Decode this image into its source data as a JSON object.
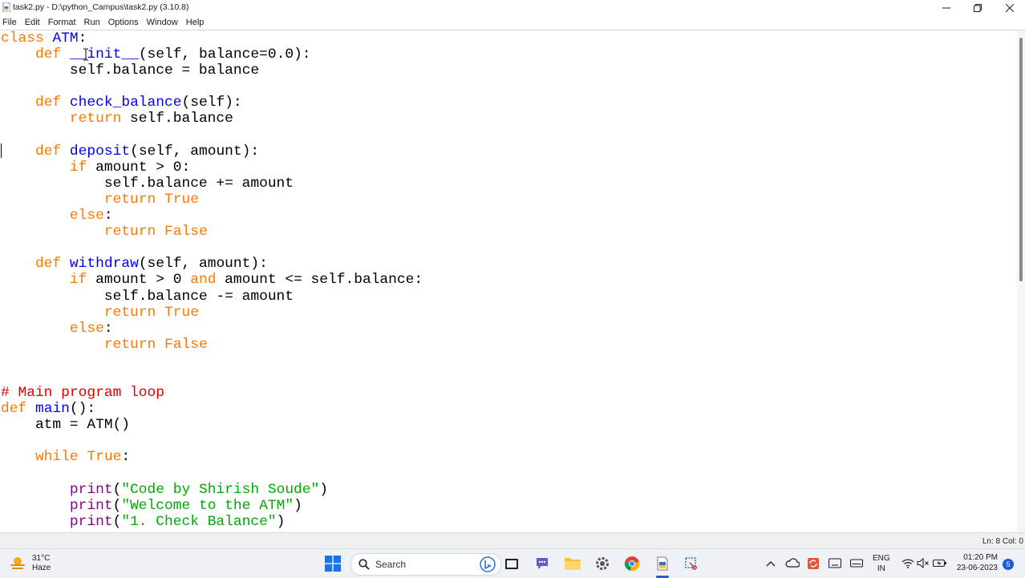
{
  "window": {
    "title": "task2.py - D:\\python_Campus\\task2.py (3.10.8)",
    "controls": [
      "minimize",
      "maximize",
      "close"
    ]
  },
  "menu": [
    "File",
    "Edit",
    "Format",
    "Run",
    "Options",
    "Window",
    "Help"
  ],
  "code_lines": [
    [
      [
        "class",
        "kw"
      ],
      [
        " ",
        ""
      ],
      [
        "ATM",
        "df"
      ],
      [
        ":",
        ""
      ]
    ],
    [
      [
        "    ",
        ""
      ],
      [
        "def",
        "kw"
      ],
      [
        " ",
        ""
      ],
      [
        "__init__",
        "df"
      ],
      [
        "(self, balance=0.0):",
        ""
      ]
    ],
    [
      [
        "        self.balance = balance",
        ""
      ]
    ],
    [
      [
        "",
        ""
      ]
    ],
    [
      [
        "    ",
        ""
      ],
      [
        "def",
        "kw"
      ],
      [
        " ",
        ""
      ],
      [
        "check_balance",
        "df"
      ],
      [
        "(self):",
        ""
      ]
    ],
    [
      [
        "        ",
        ""
      ],
      [
        "return",
        "kw"
      ],
      [
        " self.balance",
        ""
      ]
    ],
    [
      [
        "",
        ""
      ]
    ],
    [
      [
        "    ",
        ""
      ],
      [
        "def",
        "kw"
      ],
      [
        " ",
        ""
      ],
      [
        "deposit",
        "df"
      ],
      [
        "(self, amount):",
        ""
      ]
    ],
    [
      [
        "        ",
        ""
      ],
      [
        "if",
        "kw"
      ],
      [
        " amount > 0:",
        ""
      ]
    ],
    [
      [
        "            self.balance += amount",
        ""
      ]
    ],
    [
      [
        "            ",
        ""
      ],
      [
        "return",
        "kw"
      ],
      [
        " ",
        ""
      ],
      [
        "True",
        "kw"
      ]
    ],
    [
      [
        "        ",
        ""
      ],
      [
        "else",
        "kw"
      ],
      [
        ":",
        ""
      ]
    ],
    [
      [
        "            ",
        ""
      ],
      [
        "return",
        "kw"
      ],
      [
        " ",
        ""
      ],
      [
        "False",
        "kw"
      ]
    ],
    [
      [
        "",
        ""
      ]
    ],
    [
      [
        "    ",
        ""
      ],
      [
        "def",
        "kw"
      ],
      [
        " ",
        ""
      ],
      [
        "withdraw",
        "df"
      ],
      [
        "(self, amount):",
        ""
      ]
    ],
    [
      [
        "        ",
        ""
      ],
      [
        "if",
        "kw"
      ],
      [
        " amount > 0 ",
        ""
      ],
      [
        "and",
        "kw"
      ],
      [
        " amount <= self.balance:",
        ""
      ]
    ],
    [
      [
        "            self.balance -= amount",
        ""
      ]
    ],
    [
      [
        "            ",
        ""
      ],
      [
        "return",
        "kw"
      ],
      [
        " ",
        ""
      ],
      [
        "True",
        "kw"
      ]
    ],
    [
      [
        "        ",
        ""
      ],
      [
        "else",
        "kw"
      ],
      [
        ":",
        ""
      ]
    ],
    [
      [
        "            ",
        ""
      ],
      [
        "return",
        "kw"
      ],
      [
        " ",
        ""
      ],
      [
        "False",
        "kw"
      ]
    ],
    [
      [
        "",
        ""
      ]
    ],
    [
      [
        "",
        ""
      ]
    ],
    [
      [
        "# Main program loop",
        "cm"
      ]
    ],
    [
      [
        "def",
        "kw"
      ],
      [
        " ",
        ""
      ],
      [
        "main",
        "df"
      ],
      [
        "():",
        ""
      ]
    ],
    [
      [
        "    atm = ATM()",
        ""
      ]
    ],
    [
      [
        "",
        ""
      ]
    ],
    [
      [
        "    ",
        ""
      ],
      [
        "while",
        "kw"
      ],
      [
        " ",
        ""
      ],
      [
        "True",
        "kw"
      ],
      [
        ":",
        ""
      ]
    ],
    [
      [
        "",
        ""
      ]
    ],
    [
      [
        "        ",
        ""
      ],
      [
        "print",
        "bi"
      ],
      [
        "(",
        ""
      ],
      [
        "\"Code by Shirish Soude\"",
        "st"
      ],
      [
        ")",
        ""
      ]
    ],
    [
      [
        "        ",
        ""
      ],
      [
        "print",
        "bi"
      ],
      [
        "(",
        ""
      ],
      [
        "\"Welcome to the ATM\"",
        "st"
      ],
      [
        ")",
        ""
      ]
    ],
    [
      [
        "        ",
        ""
      ],
      [
        "print",
        "bi"
      ],
      [
        "(",
        ""
      ],
      [
        "\"1. Check Balance\"",
        "st"
      ],
      [
        ")",
        ""
      ]
    ]
  ],
  "status": {
    "position": "Ln: 8   Col: 0"
  },
  "taskbar": {
    "weather_temp": "31°C",
    "weather_desc": "Haze",
    "search_label": "Search",
    "lang": "ENG",
    "region": "IN",
    "time": "01:20 PM",
    "date": "23-06-2023",
    "notification_count": "5"
  }
}
